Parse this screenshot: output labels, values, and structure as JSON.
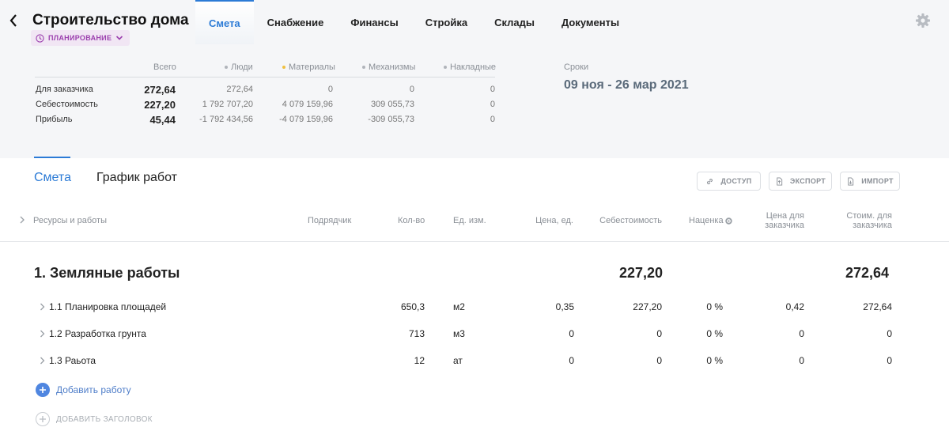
{
  "header": {
    "title": "Строительство дома",
    "status": "ПЛАНИРОВАНИЕ",
    "tabs": [
      "Смета",
      "Снабжение",
      "Финансы",
      "Стройка",
      "Склады",
      "Документы"
    ],
    "active_tab": "Смета"
  },
  "summary": {
    "columns": [
      "Всего",
      "Люди",
      "Материалы",
      "Механизмы",
      "Накладные"
    ],
    "column_dot_colors": [
      "",
      "#b0b4ba",
      "#f0c040",
      "#b0b4ba",
      "#b0b4ba"
    ],
    "rows": [
      {
        "label": "Для заказчика",
        "total": "272,64",
        "people": "272,64",
        "materials": "0",
        "machines": "0",
        "overhead": "0"
      },
      {
        "label": "Себестоимость",
        "total": "227,20",
        "people": "1 792 707,20",
        "materials": "4 079 159,96",
        "machines": "309 055,73",
        "overhead": "0"
      },
      {
        "label": "Прибыль",
        "total": "45,44",
        "people": "-1 792 434,56",
        "materials": "-4 079 159,96",
        "machines": "-309 055,73",
        "overhead": "0"
      }
    ],
    "dates_label": "Сроки",
    "dates_value": "09 ноя - 26 мар 2021"
  },
  "subtabs": [
    "Смета",
    "График работ"
  ],
  "toolbar": {
    "access": "ДОСТУП",
    "export": "ЭКСПОРТ",
    "import": "ИМПОРТ"
  },
  "table": {
    "headers": {
      "resources": "Ресурсы и работы",
      "contractor": "Подрядчик",
      "qty": "Кол-во",
      "unit": "Ед. изм.",
      "price": "Цена, ед.",
      "cost": "Себестоимость",
      "markup": "Наценка",
      "client_price_1": "Цена для",
      "client_price_2": "заказчика",
      "client_cost_1": "Стоим. для",
      "client_cost_2": "заказчика"
    },
    "section": {
      "title": "1. Земляные работы",
      "cost": "227,20",
      "client_cost": "272,64"
    },
    "rows": [
      {
        "name": "1.1 Планировка площадей",
        "qty": "650,3",
        "unit": "м2",
        "price": "0,35",
        "cost": "227,20",
        "markup": "0 %",
        "client_price": "0,42",
        "client_cost": "272,64"
      },
      {
        "name": "1.2 Разработка грунта",
        "qty": "713",
        "unit": "м3",
        "price": "0",
        "cost": "0",
        "markup": "0 %",
        "client_price": "0",
        "client_cost": "0"
      },
      {
        "name": "1.3 Раьота",
        "qty": "12",
        "unit": "ат",
        "price": "0",
        "cost": "0",
        "markup": "0 %",
        "client_price": "0",
        "client_cost": "0"
      }
    ],
    "add_work": "Добавить работу",
    "add_heading": "ДОБАВИТЬ ЗАГОЛОВОК"
  },
  "colors": {
    "accent": "#2c7bd6",
    "status": "#9b3fae"
  }
}
